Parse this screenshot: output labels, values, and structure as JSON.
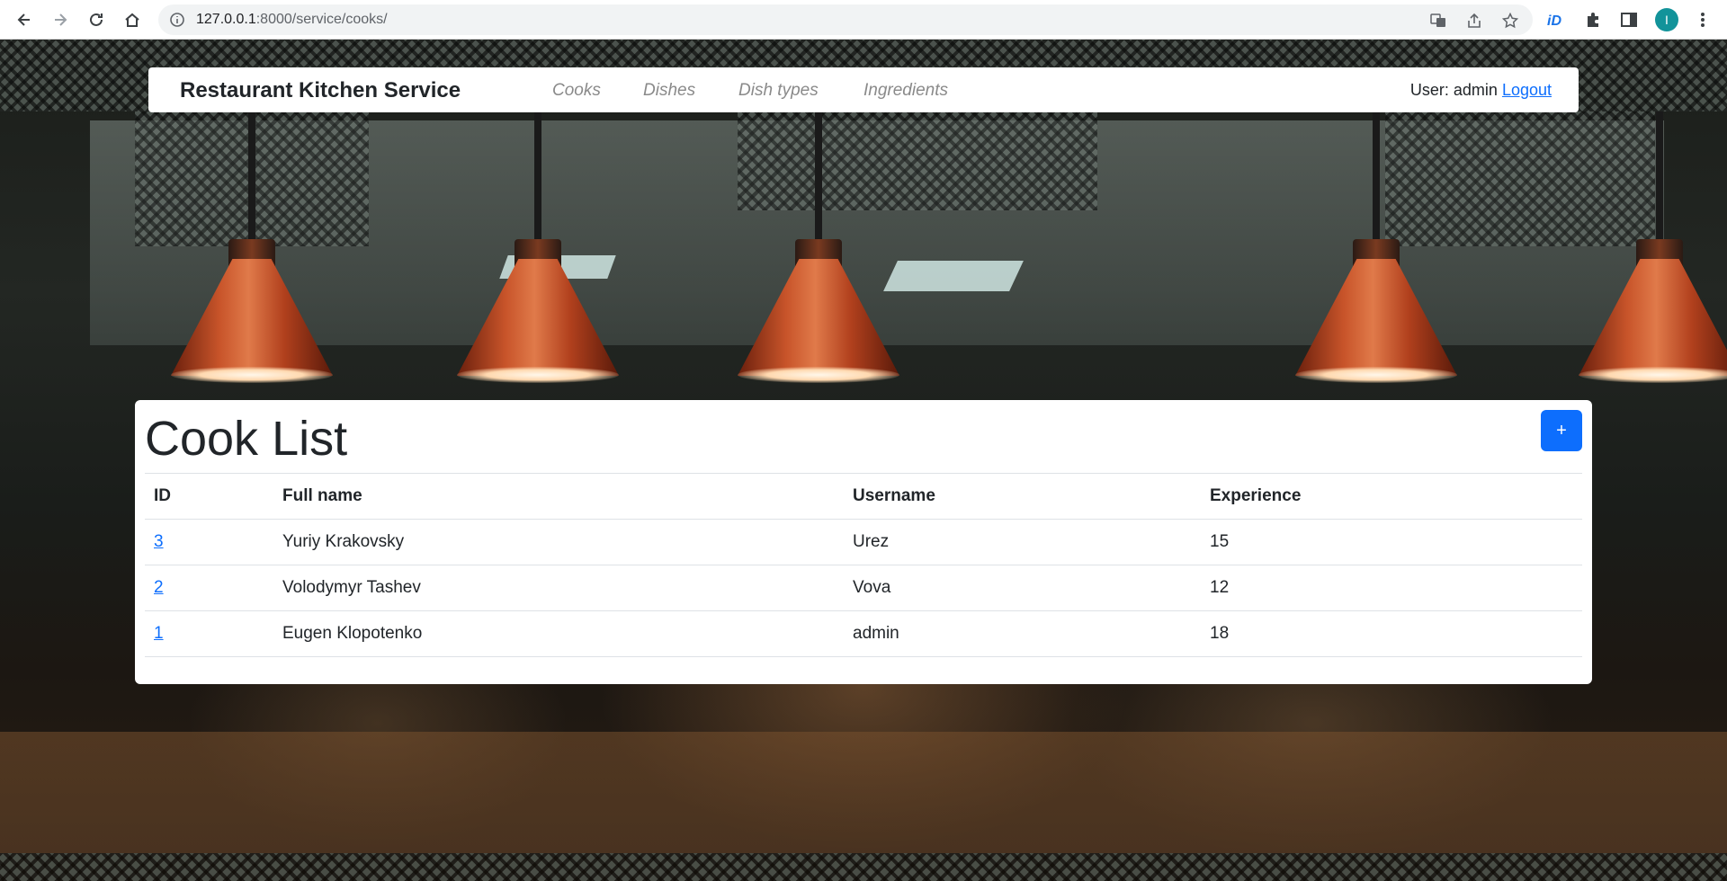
{
  "browser": {
    "url_host": "127.0.0.1",
    "url_port_path": ":8000/service/cooks/",
    "profile_initial": "I",
    "icons": [
      "back-icon",
      "forward-icon",
      "reload-icon",
      "home-icon",
      "info-icon",
      "translate-icon",
      "share-icon",
      "star-icon",
      "id-extension-icon",
      "puzzle-icon",
      "side-panel-icon",
      "more-vert-icon"
    ]
  },
  "navbar": {
    "brand": "Restaurant Kitchen Service",
    "links": [
      "Cooks",
      "Dishes",
      "Dish types",
      "Ingredients"
    ],
    "user_label": "User: admin",
    "logout": "Logout"
  },
  "main": {
    "title": "Cook List",
    "add_button": "+",
    "columns": [
      "ID",
      "Full name",
      "Username",
      "Experience"
    ],
    "rows": [
      {
        "id": "3",
        "full_name": "Yuriy Krakovsky",
        "username": "Urez",
        "experience": "15"
      },
      {
        "id": "2",
        "full_name": "Volodymyr Tashev",
        "username": "Vova",
        "experience": "12"
      },
      {
        "id": "1",
        "full_name": "Eugen Klopotenko",
        "username": "admin",
        "experience": "18"
      }
    ]
  },
  "colors": {
    "primary": "#0d6efd",
    "lamp_copper": "#c8542a",
    "profile": "#12939a"
  }
}
